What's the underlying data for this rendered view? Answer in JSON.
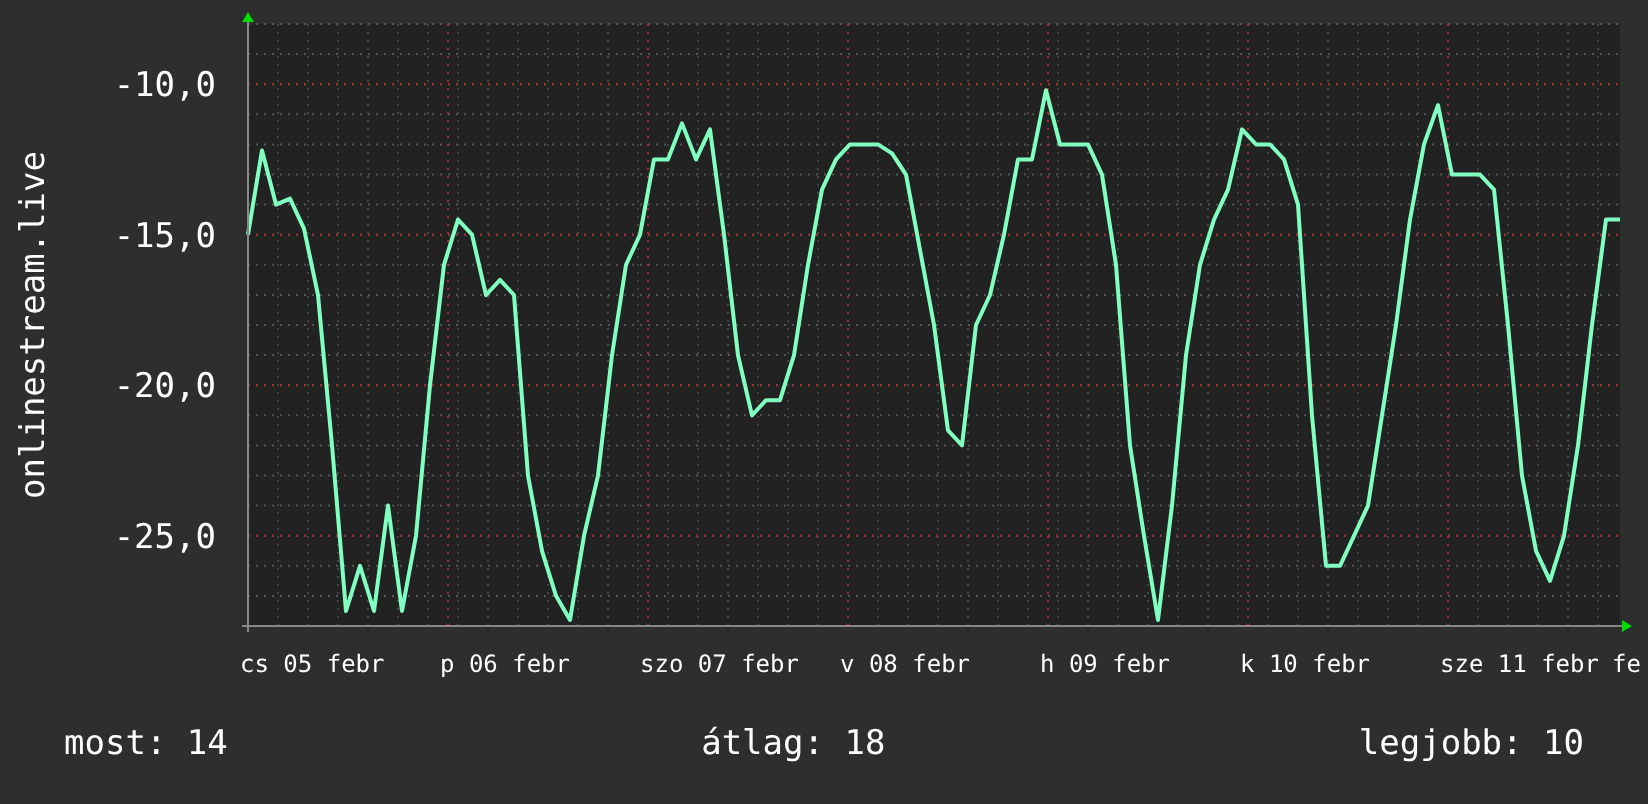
{
  "chart": {
    "x_labels": [
      "cs 05 febr",
      "p 06 febr",
      "szo 07 febr",
      "v 08 febr",
      "h 09 febr",
      "k 10 febr",
      "sze 11 febr",
      "fe"
    ],
    "chart_data": {
      "type": "line",
      "ylabel": "onlinestream.live",
      "grid": true,
      "ylim": [
        -28,
        -8
      ],
      "yticks": [
        {
          "value": -10,
          "label": "-10,0"
        },
        {
          "value": -15,
          "label": "-15,0"
        },
        {
          "value": -20,
          "label": "-20,0"
        },
        {
          "value": -25,
          "label": "-25,0"
        }
      ],
      "series": [
        {
          "color": "#80ffc0",
          "values": [
            -15,
            -12.2,
            -14,
            -13.8,
            -14.8,
            -17,
            -22,
            -27.5,
            -26,
            -27.5,
            -24,
            -27.5,
            -25,
            -20,
            -16,
            -14.5,
            -15,
            -17,
            -16.5,
            -17,
            -23,
            -25.5,
            -27,
            -27.8,
            -25,
            -23,
            -19,
            -16,
            -15,
            -12.5,
            -12.5,
            -11.3,
            -12.5,
            -11.5,
            -15,
            -19,
            -21,
            -20.5,
            -20.5,
            -19,
            -16,
            -13.5,
            -12.5,
            -12,
            -12,
            -12,
            -12.3,
            -13,
            -15.5,
            -18,
            -21.5,
            -22,
            -18,
            -17,
            -15,
            -12.5,
            -12.5,
            -10.2,
            -12,
            -12,
            -12,
            -13,
            -16,
            -22,
            -25,
            -27.8,
            -24,
            -19,
            -16,
            -14.5,
            -13.5,
            -11.5,
            -12,
            -12,
            -12.5,
            -14,
            -21,
            -26,
            -26,
            -25,
            -24,
            -21,
            -18,
            -14.5,
            -12,
            -10.7,
            -13,
            -13,
            -13,
            -13.5,
            -18,
            -23,
            -25.5,
            -26.5,
            -25,
            -22,
            -18,
            -14.5,
            -14.5
          ]
        }
      ]
    }
  },
  "legend": [
    {
      "label": "most: 14"
    },
    {
      "label": "átlag: 18"
    },
    {
      "label": "legjobb: 10"
    }
  ]
}
